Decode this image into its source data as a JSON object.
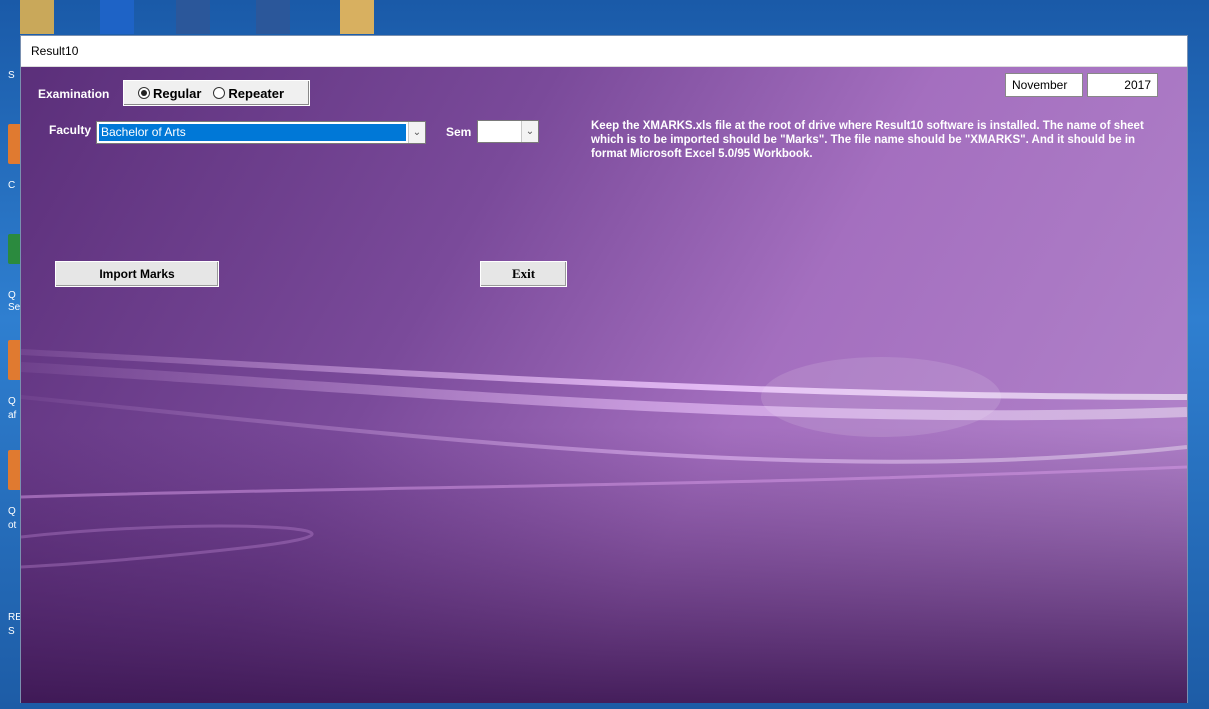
{
  "window": {
    "title": "Result10"
  },
  "form": {
    "examination_label": "Examination",
    "radio_regular": "Regular",
    "radio_repeater": "Repeater",
    "faculty_label": "Faculty",
    "faculty_value": "Bachelor of Arts",
    "sem_label": "Sem",
    "sem_value": "",
    "month": "November",
    "year": "2017",
    "info_text": "Keep the XMARKS.xls file at the root of drive where Result10 software is installed. The name of sheet which is to be imported should be \"Marks\". The file name should be \"XMARKS\". And it should be  in format Microsoft Excel 5.0/95 Workbook.",
    "import_button": "Import Marks",
    "exit_button": "Exit"
  },
  "selected_examination": "Regular",
  "desktop": {
    "left_text": [
      "S",
      "C",
      "Q",
      "Se",
      "Q",
      "af",
      "Q",
      "ot",
      "RE",
      "S"
    ]
  }
}
